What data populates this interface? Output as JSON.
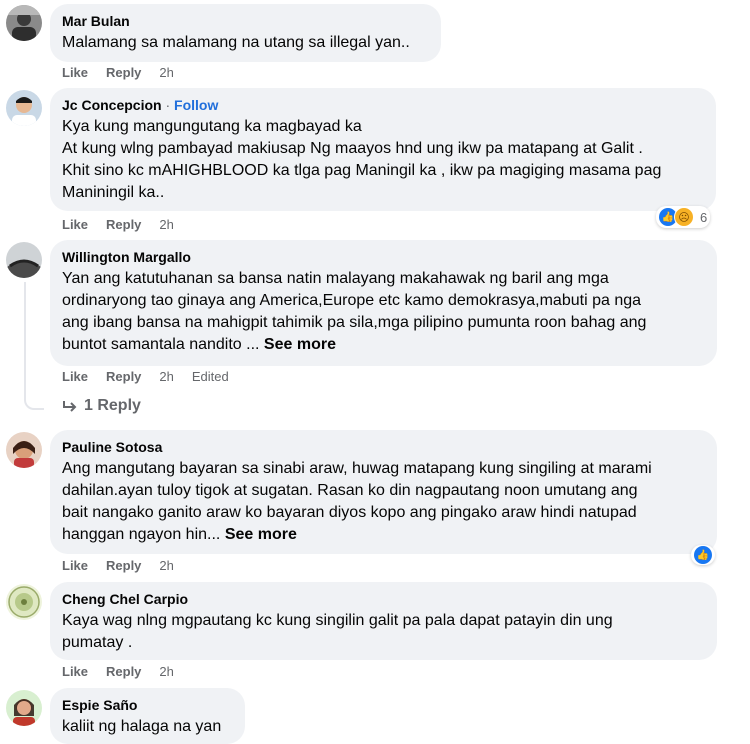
{
  "colors": {
    "bubble": "#f0f2f5",
    "link": "#216fdb",
    "meta": "#65676b",
    "like": "#1877f2"
  },
  "actions": {
    "like": "Like",
    "reply": "Reply"
  },
  "comments": [
    {
      "author": "Mar Bulan",
      "text": "Malamang sa malamang na utang sa illegal yan..",
      "time": "2h"
    },
    {
      "author": "Jc Concepcion",
      "follow": "Follow",
      "dot": "·",
      "text": "Kya kung mangungutang ka magbayad ka\nAt kung wlng pambayad makiusap Ng maayos hnd ung ikw pa matapang at Galit .\nKhit sino kc mAHIGHBLOOD ka tlga pag Maningil ka , ikw pa magiging masama pag\nManiningil ka..",
      "time": "2h",
      "reactions": {
        "icons": [
          "like-icon",
          "sad-icon"
        ],
        "count": "6"
      }
    },
    {
      "author": "Willington Margallo",
      "text": "Yan ang katutuhanan sa bansa natin malayang makahawak ng baril ang mga\nordinaryong tao ginaya ang America,Europe etc kamo demokrasya,mabuti pa nga\nang ibang bansa na mahigpit tahimik pa sila,mga pilipino pumunta roon bahag ang\nbuntot samantala nandito ...",
      "see_more": "See more",
      "time": "2h",
      "edited": "Edited",
      "replies": "1 Reply"
    },
    {
      "author": "Pauline Sotosa",
      "text": "Ang mangutang bayaran sa sinabi araw, huwag matapang kung singiling at marami\ndahilan.ayan tuloy tigok at sugatan. Rasan ko din nagpautang noon umutang ang\nbait nangako ganito araw ko bayaran diyos kopo ang pingako araw hindi natupad\nhanggan ngayon hin...",
      "see_more": "See more",
      "time": "2h",
      "reactions": {
        "icons": [
          "like-icon"
        ],
        "count": ""
      }
    },
    {
      "author": "Cheng Chel Carpio",
      "text": "Kaya wag nlng mgpautang kc kung singilin galit pa pala dapat patayin din ung\npumatay .",
      "time": "2h"
    },
    {
      "author": "Espie Saño",
      "text": "kaliit ng halaga na yan"
    }
  ]
}
